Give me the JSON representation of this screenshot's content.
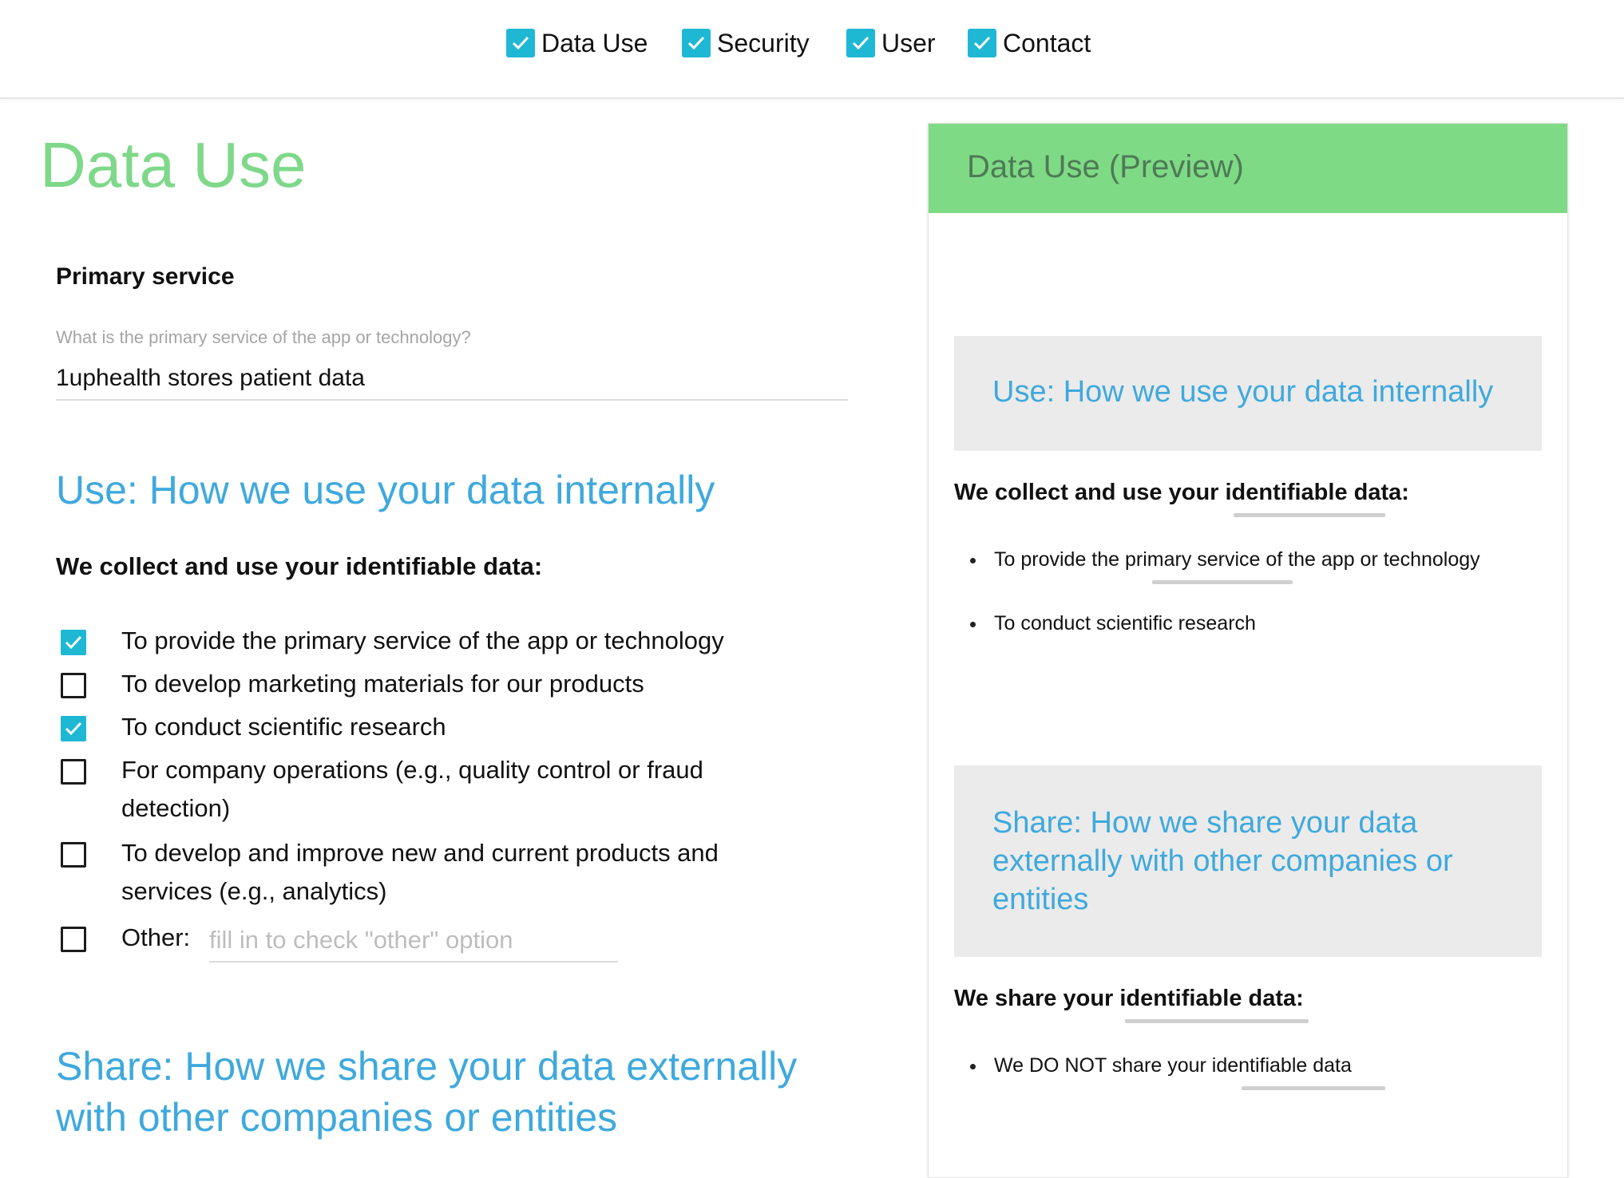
{
  "nav": {
    "items": [
      {
        "label": "Data Use",
        "checked": true
      },
      {
        "label": "Security",
        "checked": true
      },
      {
        "label": "User",
        "checked": true
      },
      {
        "label": "Contact",
        "checked": true
      }
    ]
  },
  "form": {
    "title": "Data Use",
    "primary_service": {
      "heading": "Primary service",
      "hint": "What is the primary service of the app or technology?",
      "value": "1uphealth stores patient data"
    },
    "use_section": {
      "heading": "Use: How we use your data internally",
      "subheading": "We collect and use your identifiable data:",
      "options": [
        {
          "label": "To provide the primary service of the app or technology",
          "checked": true
        },
        {
          "label": "To develop marketing materials for our products",
          "checked": false
        },
        {
          "label": "To conduct scientific research",
          "checked": true
        },
        {
          "label": "For company operations (e.g., quality control or fraud detection)",
          "checked": false
        },
        {
          "label": "To develop and improve new and current products and services (e.g., analytics)",
          "checked": false
        }
      ],
      "other_label": "Other:",
      "other_checked": false,
      "other_placeholder": "fill in to check \"other\" option"
    },
    "share_section": {
      "heading": "Share: How we share your data externally with other companies or entities"
    }
  },
  "preview": {
    "title": "Data Use (Preview)",
    "use_box_title": "Use: How we use your data internally",
    "use_subheading": "We collect and use your identifiable data:",
    "use_bullets": [
      "To provide the primary service of the app or technology",
      "To conduct scientific research"
    ],
    "share_box_title": "Share: How we share your data externally with other companies or entities",
    "share_subheading": "We share your identifiable data:",
    "share_bullets": [
      "We DO NOT share your identifiable data"
    ]
  },
  "colors": {
    "accent_green": "#7fd88a",
    "accent_blue": "#3fa9dd",
    "checkbox_teal": "#1fb8d4"
  }
}
